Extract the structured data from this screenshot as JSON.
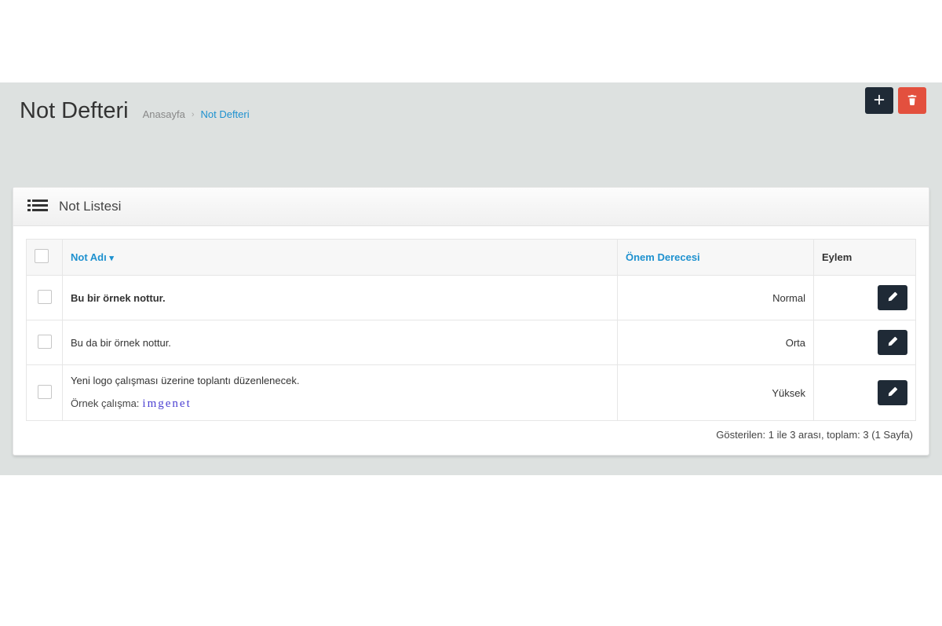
{
  "page": {
    "title": "Not Defteri"
  },
  "breadcrumb": {
    "home": "Anasayfa",
    "current": "Not Defteri"
  },
  "panel": {
    "title": "Not Listesi"
  },
  "columns": {
    "name": "Not Adı",
    "priority": "Önem Derecesi",
    "action": "Eylem"
  },
  "rows": [
    {
      "text": "Bu bir örnek nottur.",
      "bold": true,
      "priority": "Normal",
      "extra": null,
      "logo": null
    },
    {
      "text": "Bu da bir örnek nottur.",
      "bold": false,
      "priority": "Orta",
      "extra": null,
      "logo": null
    },
    {
      "text": "Yeni logo çalışması üzerine toplantı düzenlenecek.",
      "bold": false,
      "priority": "Yüksek",
      "extra": "Örnek çalışma:",
      "logo": "imgenet"
    }
  ],
  "pagination": {
    "text": "Gösterilen: 1 ile 3 arası, toplam: 3 (1 Sayfa)"
  }
}
